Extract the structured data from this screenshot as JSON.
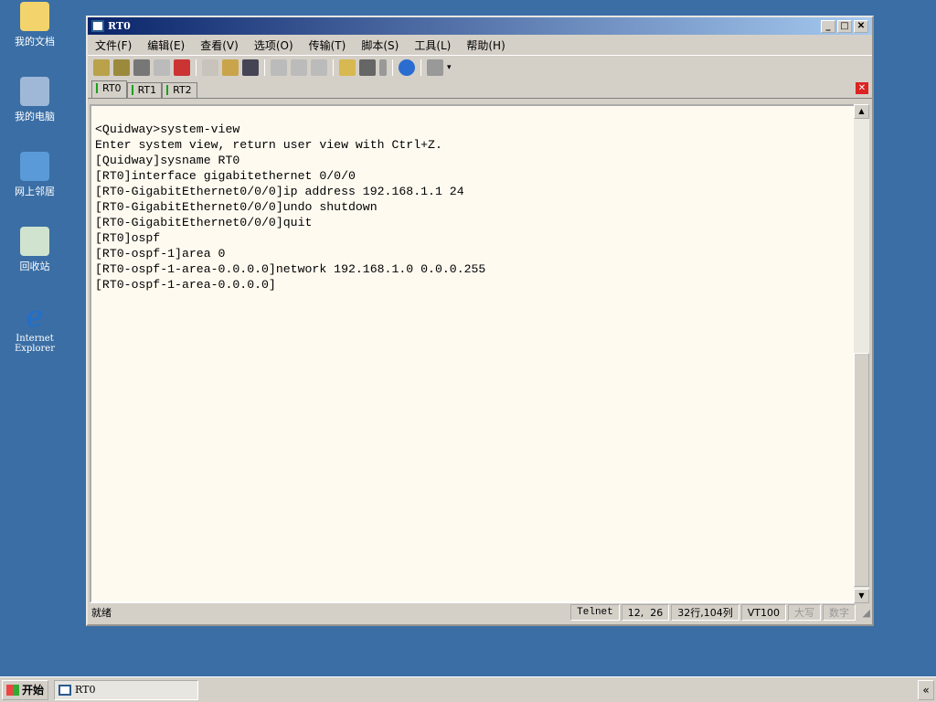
{
  "desktop": {
    "icons": [
      {
        "label": "我的文档",
        "icon": "folder-icon"
      },
      {
        "label": "我的电脑",
        "icon": "computer-icon"
      },
      {
        "label": "网上邻居",
        "icon": "network-icon"
      },
      {
        "label": "回收站",
        "icon": "recycle-bin-icon"
      },
      {
        "label": "Internet Explorer",
        "icon": "ie-icon"
      }
    ]
  },
  "window": {
    "title": "RT0",
    "menu": [
      "文件(F)",
      "编辑(E)",
      "查看(V)",
      "选项(O)",
      "传输(T)",
      "脚本(S)",
      "工具(L)",
      "帮助(H)"
    ],
    "tabs": [
      "RT0",
      "RT1",
      "RT2"
    ],
    "terminal": [
      "<Quidway>system-view",
      "Enter system view, return user view with Ctrl+Z.",
      "[Quidway]sysname RT0",
      "[RT0]interface gigabitethernet 0/0/0",
      "[RT0-GigabitEthernet0/0/0]ip address 192.168.1.1 24",
      "[RT0-GigabitEthernet0/0/0]undo shutdown",
      "[RT0-GigabitEthernet0/0/0]quit",
      "[RT0]ospf",
      "[RT0-ospf-1]area 0",
      "[RT0-ospf-1-area-0.0.0.0]network 192.168.1.0 0.0.0.255",
      "[RT0-ospf-1-area-0.0.0.0]"
    ],
    "status": {
      "ready": "就绪",
      "protocol": "Telnet",
      "cursor": "12,  26",
      "size": "32行,104列",
      "emulation": "VT100",
      "caps": "大写",
      "num": "数字"
    }
  },
  "taskbar": {
    "start": "开始",
    "task": "RT0",
    "tray": "«"
  }
}
